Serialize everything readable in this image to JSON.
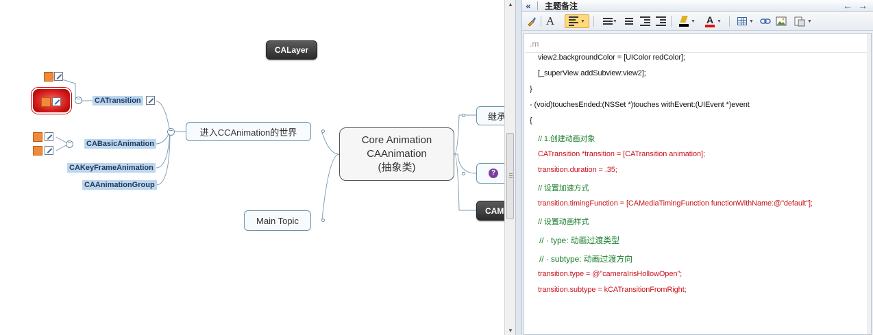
{
  "mindmap": {
    "floating_topic": "CALayer",
    "central": {
      "line1": "Core Animation",
      "line2": "CAAnimation",
      "line3": "(抽象类)"
    },
    "branch_main": "进入CCAnimation的世界",
    "main_topic": "Main Topic",
    "right_topics": {
      "first": "继承",
      "question": "?",
      "dark": "CAM"
    },
    "subtopics": [
      "CATransition",
      "CABasicAnimation",
      "CAKeyFrameAnimation",
      "CAAnimationGroup"
    ],
    "collapse_symbol": "−"
  },
  "notes_panel": {
    "header": {
      "collapse_icon": "«",
      "title": "主题备注",
      "back": "←",
      "forward": "→"
    },
    "toolbar": {
      "font_label": "A",
      "text_color_label": "A"
    },
    "filename": ".m",
    "code_lines": [
      "view2.backgroundColor = [UIColor redColor];",
      "[_superView addSubview:view2];",
      "}",
      "- (void)touchesEnded:(NSSet *)touches withEvent:(UIEvent *)event",
      "{",
      "// 1.创建动画对象",
      "CATransition *transition = [CATransition animation];",
      "transition.duration = .35;",
      "// 设置加速方式",
      "transition.timingFunction = [CAMediaTimingFunction functionWithName:@\"default\"];",
      "// 设置动画样式",
      "// · type: 动画过渡类型",
      "// · subtype: 动画过渡方向",
      "transition.type = @\"cameraIrisHollowOpen\";",
      "transition.subtype = kCATransitionFromRight;"
    ]
  },
  "colors": {
    "accent": "#2a5591",
    "code_red": "#c8141e",
    "comment_green": "#1a7f2b"
  }
}
